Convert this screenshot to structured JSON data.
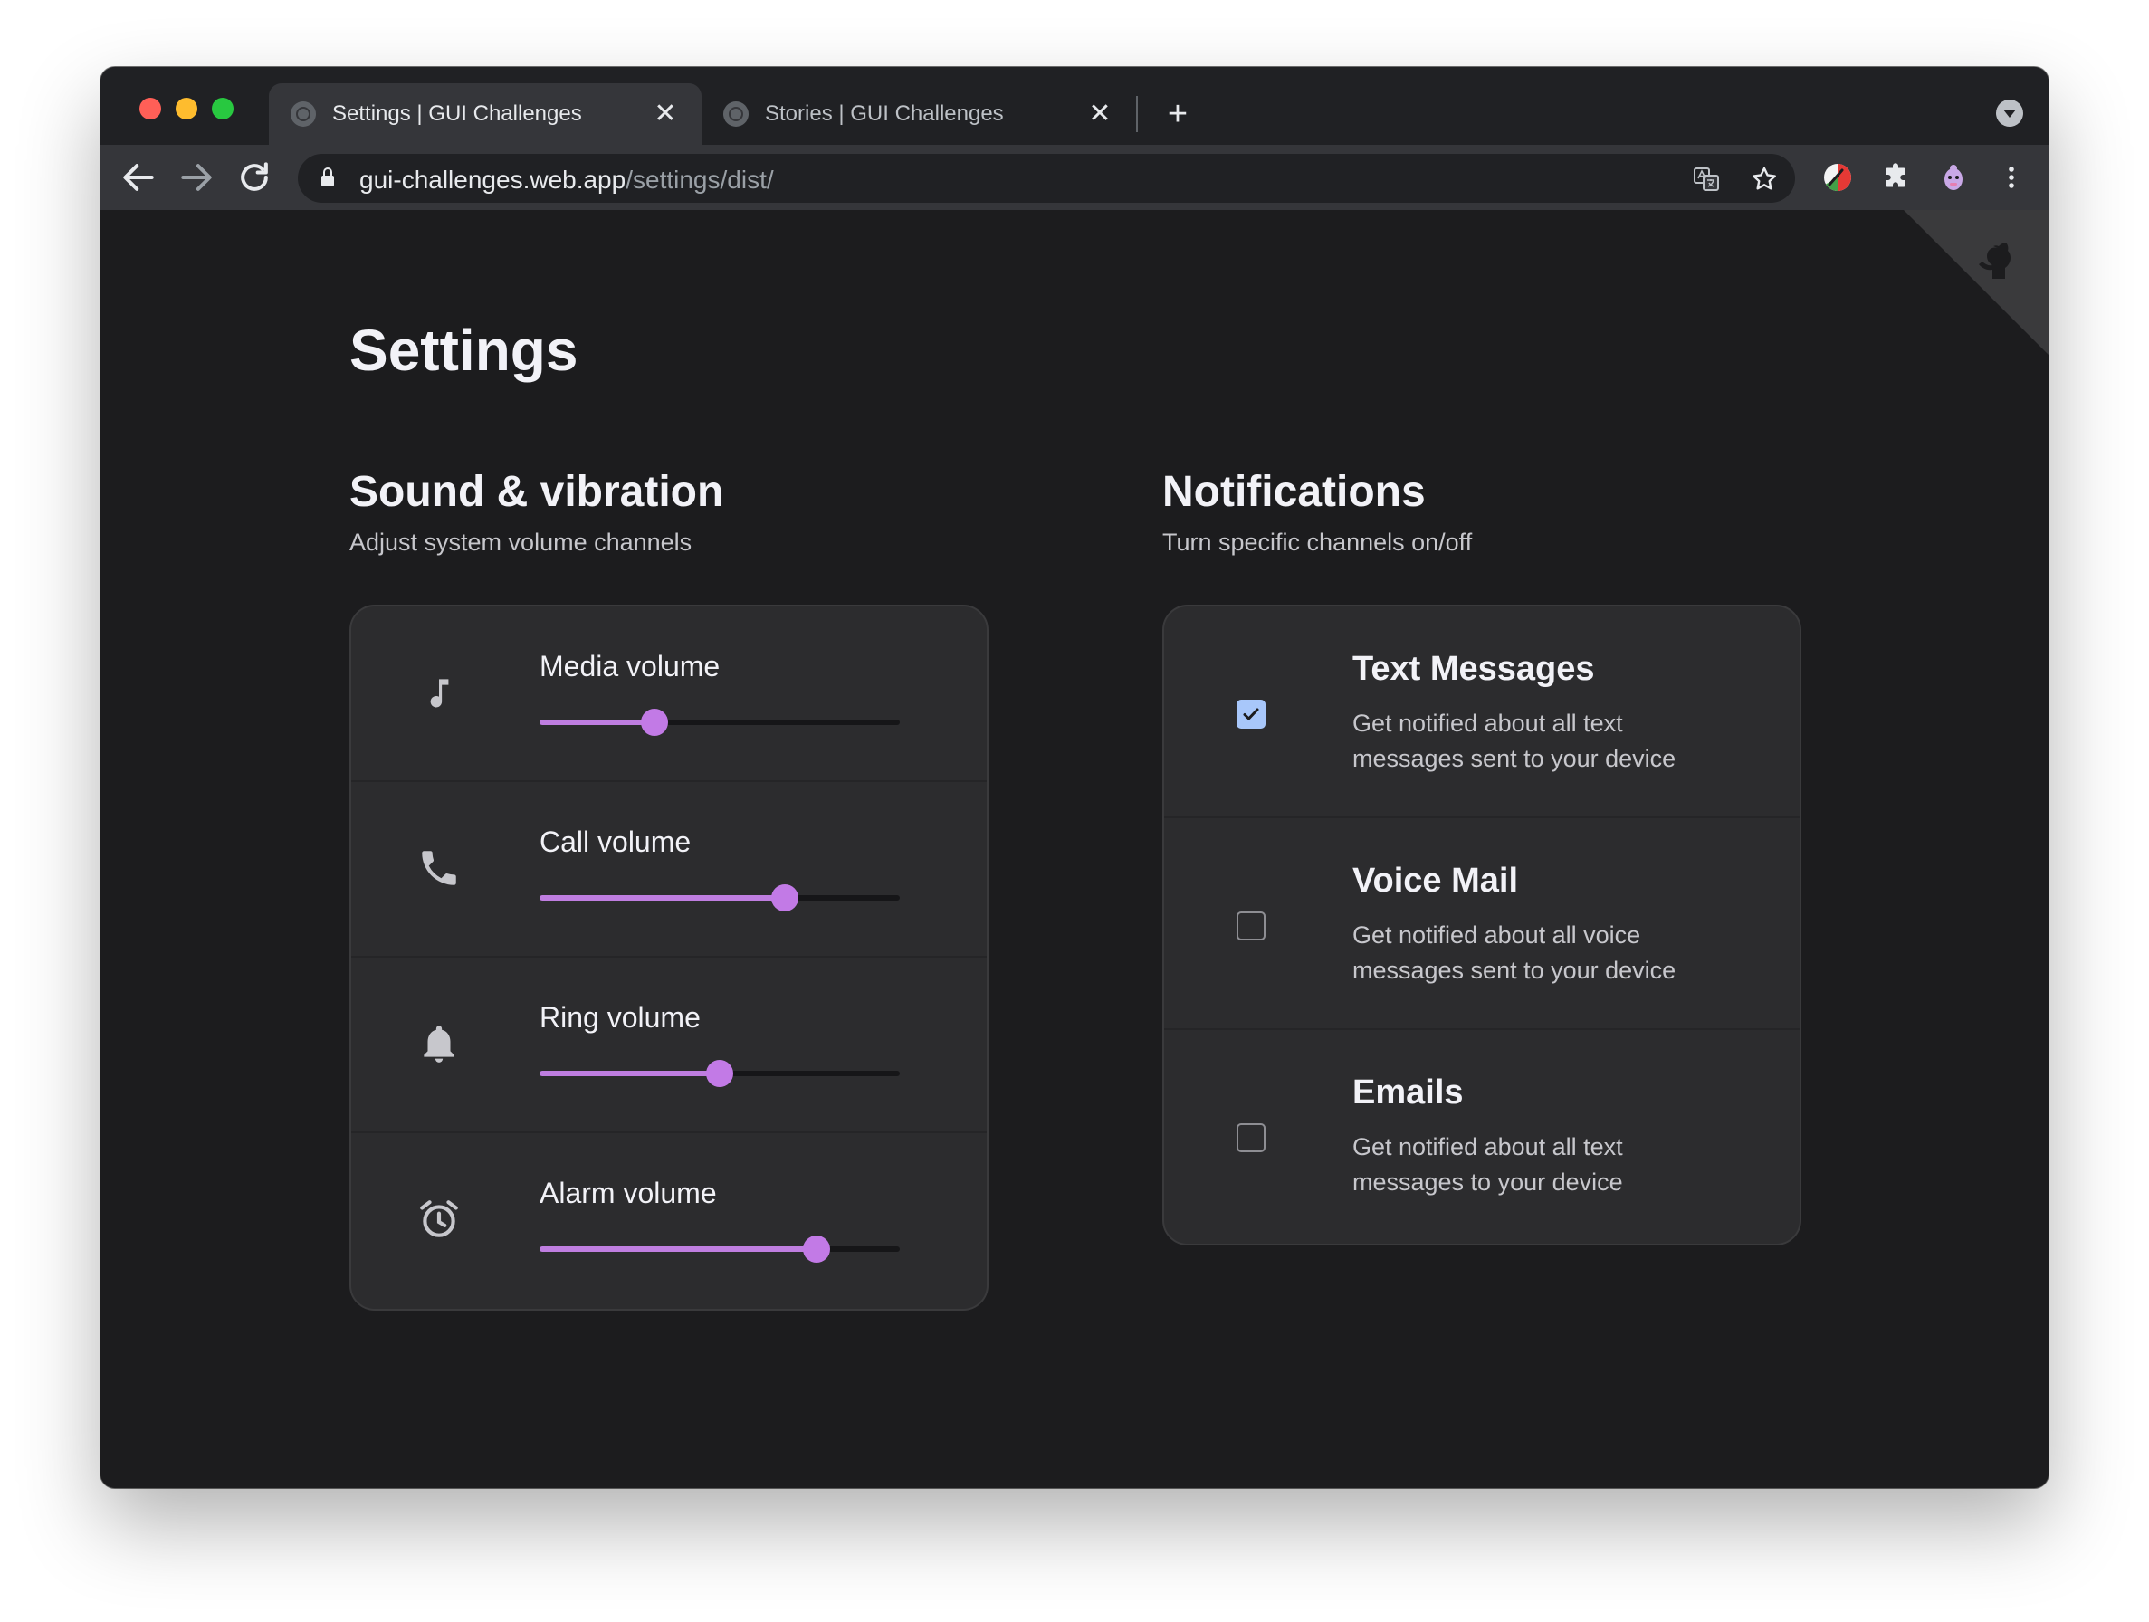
{
  "browser": {
    "tabs": [
      {
        "title": "Settings | GUI Challenges",
        "active": true,
        "close_glyph": "✕"
      },
      {
        "title": "Stories | GUI Challenges",
        "active": false,
        "close_glyph": "✕"
      }
    ],
    "new_tab_glyph": "+",
    "url": {
      "host": "gui-challenges.web.app",
      "path": "/settings/dist/"
    },
    "icons": [
      "back-arrow-icon",
      "forward-arrow-icon",
      "reload-icon",
      "lock-icon",
      "translate-icon",
      "star-icon",
      "extension-color-icon",
      "puzzle-icon",
      "profile-avatar-icon",
      "more-vertical-icon",
      "tab-search-icon",
      "github-icon"
    ]
  },
  "page": {
    "title": "Settings"
  },
  "sound": {
    "title": "Sound & vibration",
    "subtitle": "Adjust system volume channels",
    "channels": [
      {
        "label": "Media volume",
        "icon": "music-note-icon",
        "level": 0.32
      },
      {
        "label": "Call volume",
        "icon": "phone-icon",
        "level": 0.68
      },
      {
        "label": "Ring volume",
        "icon": "bell-icon",
        "level": 0.5
      },
      {
        "label": "Alarm volume",
        "icon": "alarm-clock-icon",
        "level": 0.77
      }
    ]
  },
  "notifications": {
    "title": "Notifications",
    "subtitle": "Turn specific channels on/off",
    "channels": [
      {
        "title": "Text Messages",
        "description": "Get notified about all text messages sent to your device",
        "checked": true
      },
      {
        "title": "Voice Mail",
        "description": "Get notified about all voice messages sent to your device",
        "checked": false
      },
      {
        "title": "Emails",
        "description": "Get notified about all text messages to your device",
        "checked": false
      }
    ]
  },
  "colors": {
    "accent": "#c27ae6",
    "checkbox_checked": "#a8c7fa",
    "background": "#1c1c1e",
    "card": "#2c2c2e"
  }
}
